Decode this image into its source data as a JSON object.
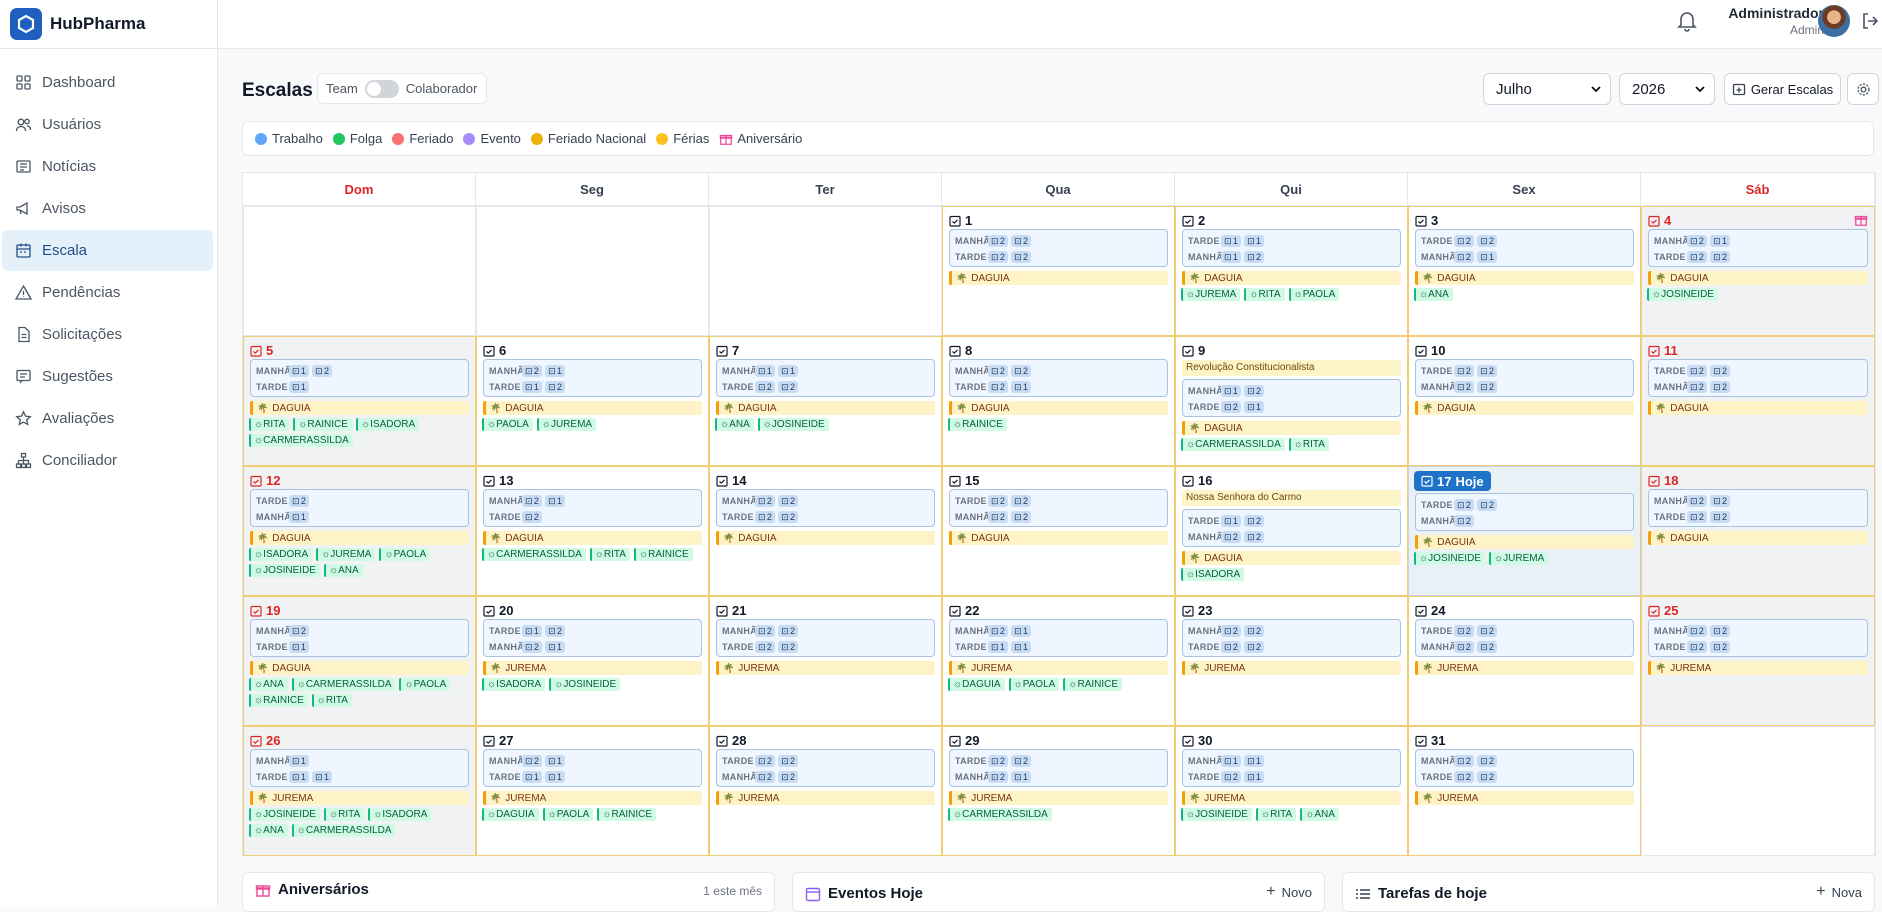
{
  "app": {
    "name": "HubPharma"
  },
  "sidebar": {
    "items": [
      {
        "label": "Dashboard",
        "icon": "grid-icon"
      },
      {
        "label": "Usuários",
        "icon": "users-icon"
      },
      {
        "label": "Notícias",
        "icon": "newspaper-icon"
      },
      {
        "label": "Avisos",
        "icon": "megaphone-icon"
      },
      {
        "label": "Escala",
        "icon": "calendar-icon",
        "active": true
      },
      {
        "label": "Pendências",
        "icon": "warning-icon"
      },
      {
        "label": "Solicitações",
        "icon": "document-icon"
      },
      {
        "label": "Sugestões",
        "icon": "message-icon"
      },
      {
        "label": "Avaliações",
        "icon": "star-icon"
      },
      {
        "label": "Conciliador",
        "icon": "network-icon"
      }
    ]
  },
  "user": {
    "name": "Administrador",
    "role": "Admin"
  },
  "page": {
    "title": "Escalas",
    "toggle_left": "Team",
    "toggle_right": "Colaborador",
    "month": "Julho",
    "year": "2026",
    "generate_label": "Gerar Escalas"
  },
  "legend": [
    {
      "label": "Trabalho",
      "color": "#60a5fa"
    },
    {
      "label": "Folga",
      "color": "#22c55e"
    },
    {
      "label": "Feriado",
      "color": "#f87171"
    },
    {
      "label": "Evento",
      "color": "#a78bfa"
    },
    {
      "label": "Feriado Nacional",
      "color": "#eab308"
    },
    {
      "label": "Férias",
      "color": "#fbbf24"
    },
    {
      "label": "Aniversário",
      "color": "#ec4899",
      "icon": "gift-icon"
    }
  ],
  "weekdays": [
    "Dom",
    "Seg",
    "Ter",
    "Qua",
    "Qui",
    "Sex",
    "Sáb"
  ],
  "calendar": {
    "days": [
      {
        "day": "1",
        "s": [
          [
            "MANHÃ",
            "2",
            "2"
          ],
          [
            "TARDE",
            "2",
            "2"
          ]
        ],
        "f": "DAGUIA",
        "c": []
      },
      {
        "day": "2",
        "s": [
          [
            "TARDE",
            "1",
            "1"
          ],
          [
            "MANHÃ",
            "1",
            "2"
          ]
        ],
        "f": "DAGUIA",
        "c": [
          "JUREMA",
          "RITA",
          "PAOLA"
        ]
      },
      {
        "day": "3",
        "s": [
          [
            "TARDE",
            "2",
            "2"
          ],
          [
            "MANHÃ",
            "2",
            "1"
          ]
        ],
        "f": "DAGUIA",
        "c": [
          "ANA"
        ]
      },
      {
        "day": "4",
        "s": [
          [
            "MANHÃ",
            "2",
            "1"
          ],
          [
            "TARDE",
            "2",
            "2"
          ]
        ],
        "f": "DAGUIA",
        "c": [
          "JOSINEIDE"
        ],
        "gift": true
      },
      {
        "day": "5",
        "s": [
          [
            "MANHÃ",
            "1",
            "2"
          ],
          [
            "TARDE",
            "1"
          ]
        ],
        "f": "DAGUIA",
        "c": [
          "RITA",
          "RAINICE",
          "ISADORA",
          "CARMERASSILDA"
        ]
      },
      {
        "day": "6",
        "s": [
          [
            "MANHÃ",
            "2",
            "1"
          ],
          [
            "TARDE",
            "1",
            "2"
          ]
        ],
        "f": "DAGUIA",
        "c": [
          "PAOLA",
          "JUREMA"
        ]
      },
      {
        "day": "7",
        "s": [
          [
            "MANHÃ",
            "1",
            "1"
          ],
          [
            "TARDE",
            "2",
            "2"
          ]
        ],
        "f": "DAGUIA",
        "c": [
          "ANA",
          "JOSINEIDE"
        ]
      },
      {
        "day": "8",
        "s": [
          [
            "MANHÃ",
            "2",
            "2"
          ],
          [
            "TARDE",
            "2",
            "1"
          ]
        ],
        "f": "DAGUIA",
        "c": [
          "RAINICE"
        ]
      },
      {
        "day": "9",
        "event": "Revolução Constitucionalista",
        "s": [
          [
            "MANHÃ",
            "1",
            "2"
          ],
          [
            "TARDE",
            "2",
            "1"
          ]
        ],
        "f": "DAGUIA",
        "c": [
          "CARMERASSILDA",
          "RITA"
        ]
      },
      {
        "day": "10",
        "s": [
          [
            "TARDE",
            "2",
            "2"
          ],
          [
            "MANHÃ",
            "2",
            "2"
          ]
        ],
        "f": "DAGUIA",
        "c": []
      },
      {
        "day": "11",
        "s": [
          [
            "TARDE",
            "2",
            "2"
          ],
          [
            "MANHÃ",
            "2",
            "2"
          ]
        ],
        "f": "DAGUIA",
        "c": []
      },
      {
        "day": "12",
        "s": [
          [
            "TARDE",
            "2"
          ],
          [
            "MANHÃ",
            "1"
          ]
        ],
        "f": "DAGUIA",
        "c": [
          "ISADORA",
          "JUREMA",
          "PAOLA",
          "JOSINEIDE",
          "ANA"
        ]
      },
      {
        "day": "13",
        "s": [
          [
            "MANHÃ",
            "2",
            "1"
          ],
          [
            "TARDE",
            "2"
          ]
        ],
        "f": "DAGUIA",
        "c": [
          "CARMERASSILDA",
          "RITA",
          "RAINICE"
        ]
      },
      {
        "day": "14",
        "s": [
          [
            "MANHÃ",
            "2",
            "2"
          ],
          [
            "TARDE",
            "2",
            "2"
          ]
        ],
        "f": "DAGUIA",
        "c": []
      },
      {
        "day": "15",
        "s": [
          [
            "TARDE",
            "2",
            "2"
          ],
          [
            "MANHÃ",
            "2",
            "2"
          ]
        ],
        "f": "DAGUIA",
        "c": []
      },
      {
        "day": "16",
        "event": "Nossa Senhora do Carmo",
        "s": [
          [
            "TARDE",
            "1",
            "2"
          ],
          [
            "MANHÃ",
            "2",
            "2"
          ]
        ],
        "f": "DAGUIA",
        "c": [
          "ISADORA"
        ]
      },
      {
        "day": "17",
        "today": "Hoje",
        "s": [
          [
            "TARDE",
            "2",
            "2"
          ],
          [
            "MANHÃ",
            "2"
          ]
        ],
        "f": "DAGUIA",
        "c": [
          "JOSINEIDE",
          "JUREMA"
        ]
      },
      {
        "day": "18",
        "s": [
          [
            "MANHÃ",
            "2",
            "2"
          ],
          [
            "TARDE",
            "2",
            "2"
          ]
        ],
        "f": "DAGUIA",
        "c": []
      },
      {
        "day": "19",
        "s": [
          [
            "MANHÃ",
            "2"
          ],
          [
            "TARDE",
            "1"
          ]
        ],
        "f": "DAGUIA",
        "c": [
          "ANA",
          "CARMERASSILDA",
          "PAOLA",
          "RAINICE",
          "RITA"
        ]
      },
      {
        "day": "20",
        "s": [
          [
            "TARDE",
            "1",
            "2"
          ],
          [
            "MANHÃ",
            "2",
            "1"
          ]
        ],
        "f": "JUREMA",
        "c": [
          "ISADORA",
          "JOSINEIDE"
        ]
      },
      {
        "day": "21",
        "s": [
          [
            "MANHÃ",
            "2",
            "2"
          ],
          [
            "TARDE",
            "2",
            "2"
          ]
        ],
        "f": "JUREMA",
        "c": []
      },
      {
        "day": "22",
        "s": [
          [
            "MANHÃ",
            "2",
            "1"
          ],
          [
            "TARDE",
            "1",
            "1"
          ]
        ],
        "f": "JUREMA",
        "c": [
          "DAGUIA",
          "PAOLA",
          "RAINICE"
        ]
      },
      {
        "day": "23",
        "s": [
          [
            "MANHÃ",
            "2",
            "2"
          ],
          [
            "TARDE",
            "2",
            "2"
          ]
        ],
        "f": "JUREMA",
        "c": []
      },
      {
        "day": "24",
        "s": [
          [
            "TARDE",
            "2",
            "2"
          ],
          [
            "MANHÃ",
            "2",
            "2"
          ]
        ],
        "f": "JUREMA",
        "c": []
      },
      {
        "day": "25",
        "s": [
          [
            "MANHÃ",
            "2",
            "2"
          ],
          [
            "TARDE",
            "2",
            "2"
          ]
        ],
        "f": "JUREMA",
        "c": []
      },
      {
        "day": "26",
        "s": [
          [
            "MANHÃ",
            "1"
          ],
          [
            "TARDE",
            "1",
            "1"
          ]
        ],
        "f": "JUREMA",
        "c": [
          "JOSINEIDE",
          "RITA",
          "ISADORA",
          "ANA",
          "CARMERASSILDA"
        ]
      },
      {
        "day": "27",
        "s": [
          [
            "MANHÃ",
            "2",
            "1"
          ],
          [
            "TARDE",
            "1",
            "1"
          ]
        ],
        "f": "JUREMA",
        "c": [
          "DAGUIA",
          "PAOLA",
          "RAINICE"
        ]
      },
      {
        "day": "28",
        "s": [
          [
            "TARDE",
            "2",
            "2"
          ],
          [
            "MANHÃ",
            "2",
            "2"
          ]
        ],
        "f": "JUREMA",
        "c": []
      },
      {
        "day": "29",
        "s": [
          [
            "TARDE",
            "2",
            "2"
          ],
          [
            "MANHÃ",
            "2",
            "1"
          ]
        ],
        "f": "JUREMA",
        "c": [
          "CARMERASSILDA"
        ]
      },
      {
        "day": "30",
        "s": [
          [
            "MANHÃ",
            "1",
            "1"
          ],
          [
            "TARDE",
            "2",
            "1"
          ]
        ],
        "f": "JUREMA",
        "c": [
          "JOSINEIDE",
          "RITA",
          "ANA"
        ]
      },
      {
        "day": "31",
        "s": [
          [
            "MANHÃ",
            "2",
            "2"
          ],
          [
            "TARDE",
            "2",
            "2"
          ]
        ],
        "f": "JUREMA",
        "c": []
      }
    ]
  },
  "panels": {
    "birthdays": {
      "title": "Aniversários",
      "count": "1 este mês"
    },
    "events": {
      "title": "Eventos Hoje",
      "action": "Novo"
    },
    "tasks": {
      "title": "Tarefas de hoje",
      "action": "Nova"
    }
  }
}
